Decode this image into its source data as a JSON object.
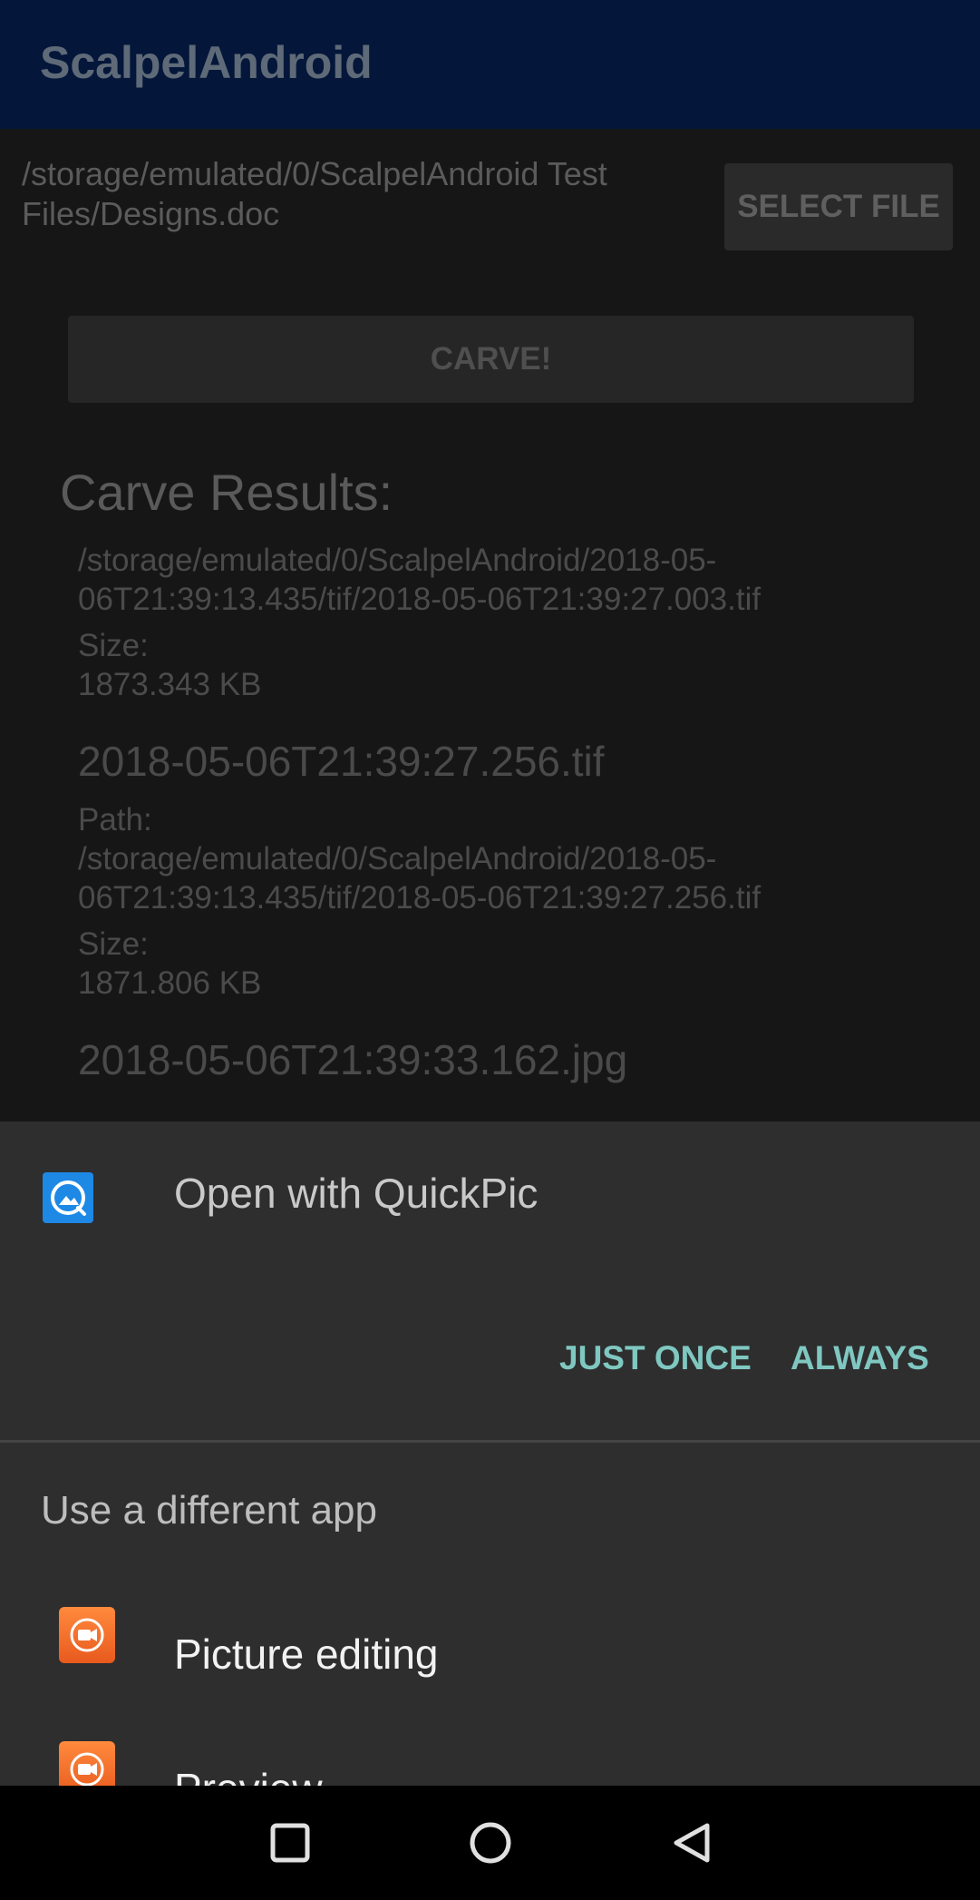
{
  "app": {
    "title": "ScalpelAndroid"
  },
  "file": {
    "path": "/storage/emulated/0/ScalpelAndroid Test Files/Designs.doc",
    "select_label": "SELECT FILE"
  },
  "carve": {
    "label": "CARVE!"
  },
  "results": {
    "heading": "Carve Results:",
    "partial_path_line1": "/storage/emulated/0/ScalpelAndroid/2018-05-",
    "partial_path_line2": "06T21:39:13.435/tif/2018-05-06T21:39:27.003.tif",
    "partial_size_label": "Size:",
    "partial_size_value": "1873.343 KB",
    "items": [
      {
        "name": "2018-05-06T21:39:27.256.tif",
        "path_label": "Path:",
        "path_line1": "/storage/emulated/0/ScalpelAndroid/2018-05-",
        "path_line2": "06T21:39:13.435/tif/2018-05-06T21:39:27.256.tif",
        "size_label": "Size:",
        "size_value": "1871.806 KB"
      },
      {
        "name": "2018-05-06T21:39:33.162.jpg"
      }
    ]
  },
  "chooser": {
    "open_with": "Open with QuickPic",
    "just_once": "JUST ONCE",
    "always": "ALWAYS",
    "different_app": "Use a different app",
    "apps": [
      {
        "label": "Picture editing",
        "icon": "camera-icon"
      },
      {
        "label": "Preview",
        "icon": "camera-icon"
      }
    ]
  },
  "colors": {
    "appbar": "#04173a",
    "accent": "#7fc8c1",
    "quickpic": "#1e88e5",
    "app_icon": "#f07030"
  }
}
